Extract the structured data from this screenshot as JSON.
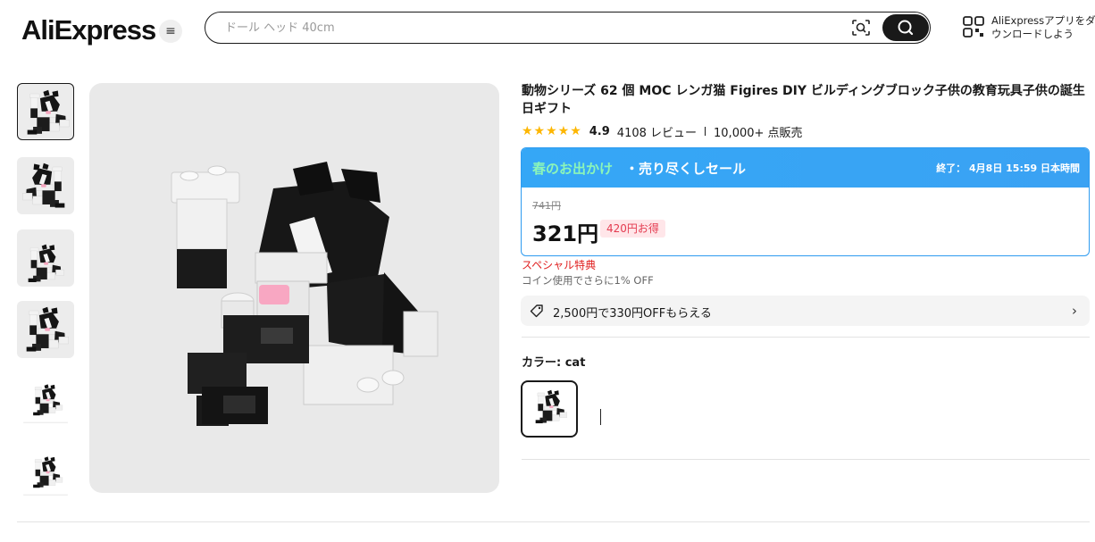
{
  "header": {
    "logo": "AliExpress",
    "menu_icon": "hamburger-icon",
    "search_placeholder": "ドール ヘッド 40cm",
    "camera_icon": "camera-search-icon",
    "search_icon": "search-icon",
    "app_download_text": "AliExpressアプリをダウンロードしよう",
    "qr_icon": "qr-code-icon"
  },
  "gallery": {
    "thumbnails": [
      "cat-front",
      "cat-angle",
      "cat-side",
      "cat-top",
      "cat-dimensions",
      "cat-dimensions-2"
    ],
    "selected_index": 0
  },
  "product": {
    "title": "動物シリーズ 62 個 MOC レンガ猫 Figires DIY ビルディングブロック子供の教育玩具子供の誕生日ギフト",
    "stars": "★★★★★",
    "rating": "4.9",
    "reviews": "4108 レビュー",
    "sold": "10,000+ 点販売"
  },
  "sale": {
    "event": "春のお出かけ",
    "event_suffix": "・売り尽くしセール",
    "end_text": "終了： 4月8日 15:59 日本時間",
    "original_price": "741円",
    "price": "321円",
    "discount": "420円お得",
    "accent_color": "#35a7f6",
    "event_color": "#8cf5b8"
  },
  "benefits": {
    "special": "スペシャル特典",
    "coin": "コイン使用でさらに1% OFF",
    "coupon": "2,500円で330円OFFもらえる",
    "coupon_icon": "tag-icon",
    "chevron_icon": "chevron-right-icon"
  },
  "variants": {
    "label": "カラー: cat",
    "options": [
      "cat"
    ]
  }
}
